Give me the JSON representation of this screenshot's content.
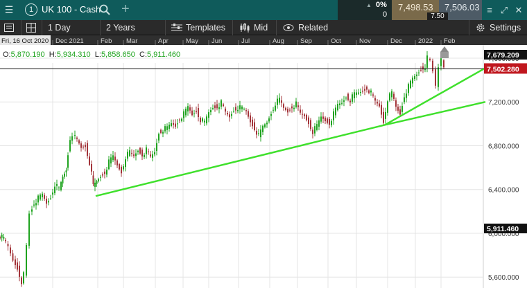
{
  "header": {
    "menu_icon": "hamburger-icon",
    "instrument_number": "1",
    "instrument_name": "UK 100 - Cash",
    "search_icon": "search-icon",
    "add_icon": "plus-icon",
    "change_pct": "0%",
    "change_points": "0",
    "bid": "7,498.53",
    "spread": "7.50",
    "ask": "7,506.03",
    "right_icons": [
      "list-icon",
      "expand-icon",
      "close-icon"
    ]
  },
  "toolbar": {
    "interval": "1 Day",
    "period": "2 Years",
    "templates": "Templates",
    "price_type": "Mid",
    "related": "Related",
    "settings": "Settings"
  },
  "ohlc": {
    "o_label": "O:",
    "o": "5,870.190",
    "h_label": "H:",
    "h": "5,934.310",
    "l_label": "L:",
    "l": "5,858.650",
    "c_label": "C:",
    "c": "5,911.460"
  },
  "chart_data": {
    "type": "candlestick",
    "x_start_label": "Fri, 16 Oct 2020",
    "x_tick_labels": [
      "Dec 2021",
      "Feb",
      "Mar",
      "Apr",
      "May",
      "Jun",
      "Jul",
      "Aug",
      "Sep",
      "Oct",
      "Nov",
      "Dec",
      "2022",
      "Feb"
    ],
    "y_tick_labels": [
      "7,600.000",
      "7,200.000",
      "6,800.000",
      "6,400.000",
      "6,000.000",
      "5,600.000"
    ],
    "ylim": [
      5500,
      7720
    ],
    "price_labels": {
      "high": "7,679.209",
      "current": "7,502.280",
      "hover": "5,911.460"
    },
    "current_price": 7502.28,
    "series_points": [
      [
        0,
        5990
      ],
      [
        8,
        5950
      ],
      [
        15,
        5870
      ],
      [
        22,
        5750
      ],
      [
        28,
        5680
      ],
      [
        34,
        5560
      ],
      [
        38,
        5620
      ],
      [
        42,
        5880
      ],
      [
        46,
        6180
      ],
      [
        52,
        6280
      ],
      [
        58,
        6320
      ],
      [
        64,
        6350
      ],
      [
        70,
        6270
      ],
      [
        76,
        6330
      ],
      [
        82,
        6450
      ],
      [
        88,
        6400
      ],
      [
        93,
        6510
      ],
      [
        98,
        6580
      ],
      [
        104,
        6870
      ],
      [
        108,
        6910
      ],
      [
        114,
        6850
      ],
      [
        120,
        6780
      ],
      [
        126,
        6800
      ],
      [
        132,
        6650
      ],
      [
        137,
        6430
      ],
      [
        142,
        6470
      ],
      [
        148,
        6520
      ],
      [
        154,
        6560
      ],
      [
        160,
        6650
      ],
      [
        166,
        6700
      ],
      [
        172,
        6620
      ],
      [
        178,
        6560
      ],
      [
        184,
        6700
      ],
      [
        190,
        6740
      ],
      [
        196,
        6700
      ],
      [
        202,
        6760
      ],
      [
        208,
        6720
      ],
      [
        214,
        6760
      ],
      [
        220,
        6690
      ],
      [
        226,
        6740
      ],
      [
        232,
        6920
      ],
      [
        238,
        6950
      ],
      [
        244,
        6960
      ],
      [
        250,
        7000
      ],
      [
        256,
        6980
      ],
      [
        262,
        7050
      ],
      [
        268,
        7090
      ],
      [
        274,
        7150
      ],
      [
        280,
        7080
      ],
      [
        286,
        7120
      ],
      [
        292,
        7040
      ],
      [
        298,
        7010
      ],
      [
        304,
        7100
      ],
      [
        310,
        7150
      ],
      [
        316,
        7160
      ],
      [
        322,
        7190
      ],
      [
        328,
        7100
      ],
      [
        334,
        7060
      ],
      [
        340,
        7130
      ],
      [
        346,
        7150
      ],
      [
        352,
        7140
      ],
      [
        358,
        7110
      ],
      [
        364,
        7020
      ],
      [
        370,
        6960
      ],
      [
        376,
        6890
      ],
      [
        382,
        6970
      ],
      [
        388,
        7010
      ],
      [
        394,
        7100
      ],
      [
        400,
        7190
      ],
      [
        406,
        7220
      ],
      [
        412,
        7140
      ],
      [
        418,
        7110
      ],
      [
        424,
        7160
      ],
      [
        430,
        7180
      ],
      [
        436,
        7090
      ],
      [
        442,
        7070
      ],
      [
        448,
        7010
      ],
      [
        454,
        6930
      ],
      [
        460,
        6980
      ],
      [
        466,
        7060
      ],
      [
        472,
        7030
      ],
      [
        478,
        7010
      ],
      [
        484,
        7090
      ],
      [
        490,
        7170
      ],
      [
        496,
        7190
      ],
      [
        502,
        7250
      ],
      [
        508,
        7220
      ],
      [
        514,
        7270
      ],
      [
        520,
        7280
      ],
      [
        526,
        7300
      ],
      [
        532,
        7330
      ],
      [
        538,
        7280
      ],
      [
        544,
        7200
      ],
      [
        550,
        7160
      ],
      [
        556,
        7020
      ],
      [
        562,
        7230
      ],
      [
        568,
        7280
      ],
      [
        574,
        7150
      ],
      [
        580,
        7090
      ],
      [
        586,
        7260
      ],
      [
        592,
        7340
      ],
      [
        598,
        7410
      ],
      [
        604,
        7450
      ],
      [
        610,
        7500
      ],
      [
        616,
        7530
      ],
      [
        620,
        7600
      ],
      [
        624,
        7570
      ],
      [
        628,
        7480
      ],
      [
        632,
        7360
      ],
      [
        636,
        7540
      ],
      [
        640,
        7580
      ],
      [
        644,
        7510
      ]
    ],
    "trendlines": [
      {
        "x1": 138,
        "y1": 6340,
        "x2": 555,
        "y2": 6990
      },
      {
        "x1": 555,
        "y1": 6990,
        "x2": 700,
        "y2": 7200
      },
      {
        "x1": 555,
        "y1": 6990,
        "x2": 700,
        "y2": 7510
      }
    ],
    "colors": {
      "up": "#1fa31f",
      "down": "#a3343a",
      "trendline": "#3fe02c",
      "grid": "#e4e4e4",
      "axis_bg": "#2a2a2a",
      "current_tag": "#c0171e"
    }
  }
}
